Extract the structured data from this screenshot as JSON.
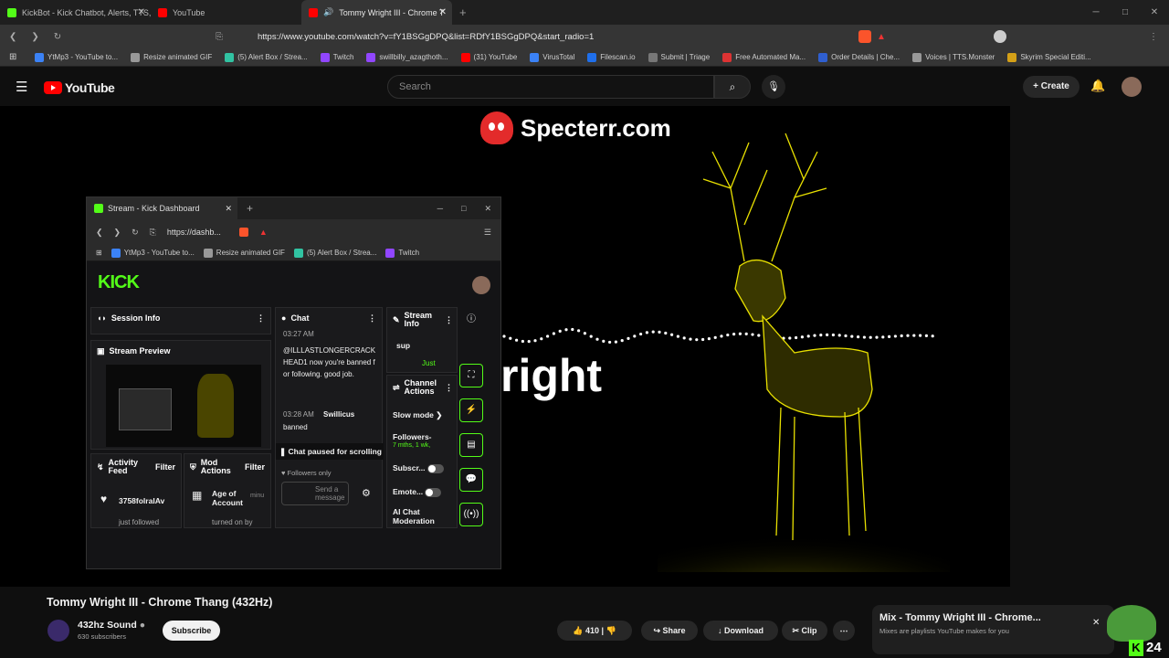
{
  "browser": {
    "tabs": [
      {
        "label": "KickBot - Kick Chatbot, Alerts, TTS, C",
        "color": "#53fc18"
      },
      {
        "label": "YouTube",
        "color": "#ff0000"
      },
      {
        "label": "Tommy Wright III - Chrome T",
        "color": "#ff0000"
      }
    ],
    "url": "https://www.youtube.com/watch?v=fY1BSGgDPQ&list=RDfY1BSGgDPQ&start_radio=1",
    "bookmarks": [
      "YtMp3 - YouTube to...",
      "Resize animated GIF",
      "(5) Alert Box / Strea...",
      "Twitch",
      "swillbilly_azagthoth...",
      "(31) YouTube",
      "VirusTotal",
      "Filescan.io",
      "Submit | Triage",
      "Free Automated Ma...",
      "Order Details | Che...",
      "Voices | TTS.Monster",
      "Skyrim Special Editi..."
    ]
  },
  "youtube": {
    "logo": "YouTube",
    "search_placeholder": "Search",
    "create_label": "Create",
    "video_title": "Tommy Wright III - Chrome Thang (432Hz)",
    "channel": "432hz Sound",
    "subscribers": "630 subscribers",
    "subscribe_label": "Subscribe",
    "likes": "410",
    "share_label": "Share",
    "download_label": "Download",
    "clip_label": "Clip",
    "mix_title": "Mix - Tommy Wright III - Chrome...",
    "mix_sub": "Mixes are playlists YouTube makes for you",
    "badge_count": "24"
  },
  "video": {
    "watermark": "Specterr.com",
    "overlay_text": "right"
  },
  "kick": {
    "tab_label": "Stream - Kick Dashboard",
    "url": "https://dashb...",
    "bookmarks": [
      "YtMp3 - YouTube to...",
      "Resize animated GIF",
      "(5) Alert Box / Strea...",
      "Twitch"
    ],
    "logo": "KICK",
    "session_info": "Session Info",
    "stream_preview": "Stream Preview",
    "chat": "Chat",
    "chat_time1": "03:27 AM",
    "chat_msg1": "@ILLLASTLONGERCRACKHEAD1 now you're banned for following. good job.",
    "chat_time2": "03:28 AM",
    "chat_user2": "Swillicus",
    "chat_msg2": "banned",
    "chat_paused": "Chat paused for scrolling",
    "followers_only": "Followers only",
    "send_placeholder": "Send a message",
    "stream_info": "Stream Info",
    "stream_info_msg": "sup",
    "stream_info_status": "Just",
    "channel_actions": "Channel Actions",
    "slow_mode": "Slow mode",
    "followers": "Followers-",
    "followers_sub": "7 mths, 1 wk,",
    "subscr": "Subscr...",
    "emote": "Emote...",
    "ai_chat": "AI Chat Moderation",
    "activity_feed": "Activity Feed",
    "filter": "Filter",
    "mod_actions": "Mod Actions",
    "activity_user": "3758folralAv",
    "activity_status": "just followed",
    "mod_item": "Age of Account",
    "mod_item_sub": "minu",
    "mod_status": "turned on by"
  }
}
